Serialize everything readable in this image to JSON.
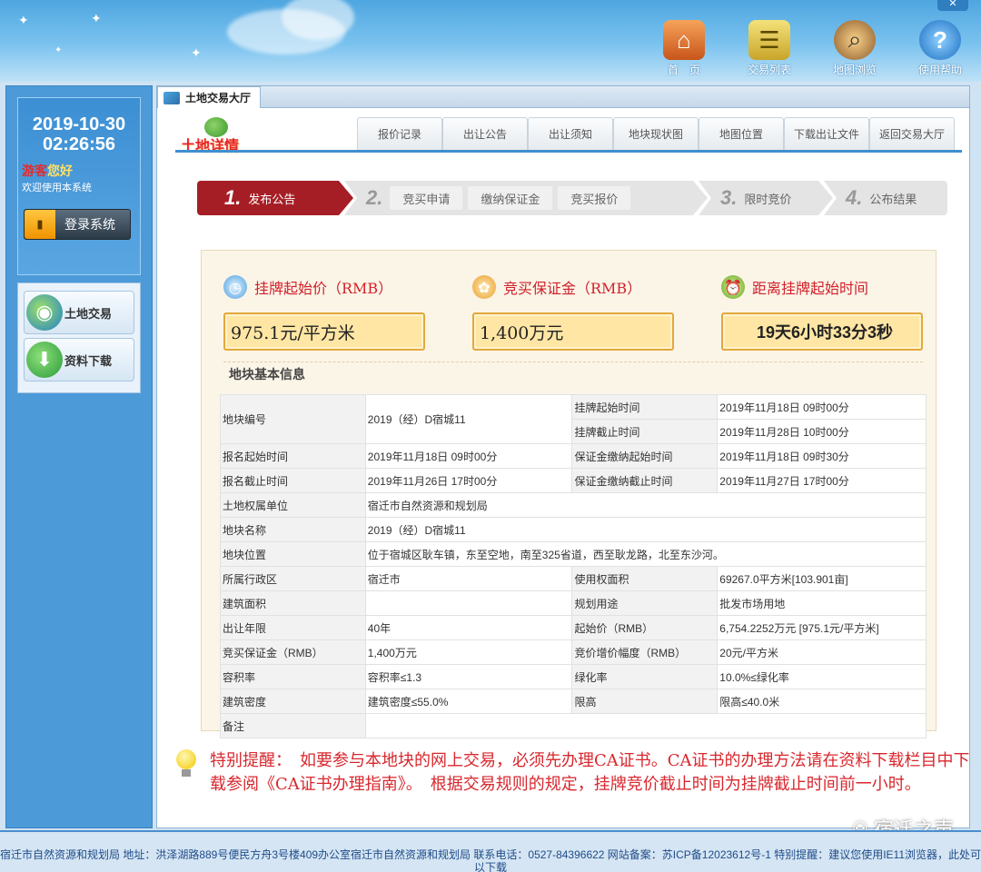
{
  "topnav": [
    {
      "label": "首　页",
      "icon": "home-icon"
    },
    {
      "label": "交易列表",
      "icon": "list-icon"
    },
    {
      "label": "地图浏览",
      "icon": "map-magnifier-icon"
    },
    {
      "label": "使用帮助",
      "icon": "help-icon"
    }
  ],
  "left": {
    "date": "2019-10-30",
    "time": "02:26:56",
    "guest": "游客",
    "hello": "您好",
    "welcome": "欢迎使用本系统",
    "login_label": "登录系统",
    "menu": [
      {
        "label": "土地交易",
        "icon": "globe-icon"
      },
      {
        "label": "资料下载",
        "icon": "download-icon"
      }
    ]
  },
  "main": {
    "tab_label": "土地交易大厅",
    "detail_title": "土地详情",
    "subtabs": [
      "报价记录",
      "出让公告",
      "出让须知",
      "地块现状图",
      "地图位置",
      "下载出让文件",
      "返回交易大厅"
    ],
    "steps": {
      "s1_num": "1.",
      "s1_label": "发布公告",
      "s2_num": "2.",
      "s2_subs": [
        "竞买申请",
        "缴纳保证金",
        "竞买报价"
      ],
      "s3_num": "3.",
      "s3_label": "限时竞价",
      "s4_num": "4.",
      "s4_label": "公布结果"
    },
    "summary": {
      "start_price_label": "挂牌起始价（RMB）",
      "start_price_value": "975.1元/平方米",
      "deposit_label": "竞买保证金（RMB）",
      "deposit_value": "1,400万元",
      "countdown_label": "距离挂牌起始时间",
      "countdown_value": "19天6小时33分3秒"
    },
    "basic_title": "地块基本信息",
    "table": {
      "r1": {
        "k": "地块编号",
        "v": "2019（经）D宿城11",
        "k2a": "挂牌起始时间",
        "v2a": "2019年11月18日 09时00分",
        "k2b": "挂牌截止时间",
        "v2b": "2019年11月28日 10时00分"
      },
      "r2": {
        "k": "报名起始时间",
        "v": "2019年11月18日 09时00分",
        "k2": "保证金缴纳起始时间",
        "v2": "2019年11月18日 09时30分"
      },
      "r3": {
        "k": "报名截止时间",
        "v": "2019年11月26日 17时00分",
        "k2": "保证金缴纳截止时间",
        "v2": "2019年11月27日 17时00分"
      },
      "r4": {
        "k": "土地权属单位",
        "v": "宿迁市自然资源和规划局"
      },
      "r5": {
        "k": "地块名称",
        "v": "2019（经）D宿城11"
      },
      "r6": {
        "k": "地块位置",
        "v": "位于宿城区耿车镇，东至空地，南至325省道，西至耿龙路，北至东沙河。"
      },
      "r7": {
        "k": "所属行政区",
        "v": "宿迁市",
        "k2": "使用权面积",
        "v2": "69267.0平方米[103.901亩]"
      },
      "r8": {
        "k": "建筑面积",
        "v": "",
        "k2": "规划用途",
        "v2": "批发市场用地"
      },
      "r9": {
        "k": "出让年限",
        "v": "40年",
        "k2": "起始价（RMB）",
        "v2": "6,754.2252万元 [975.1元/平方米]"
      },
      "r10": {
        "k": "竞买保证金（RMB）",
        "v": "1,400万元",
        "k2": "竞价增价幅度（RMB）",
        "v2": "20元/平方米"
      },
      "r11": {
        "k": "容积率",
        "v": "容积率≤1.3",
        "k2": "绿化率",
        "v2": "10.0%≤绿化率"
      },
      "r12": {
        "k": "建筑密度",
        "v": "建筑密度≤55.0%",
        "k2": "限高",
        "v2": "限高≤40.0米"
      },
      "r13": {
        "k": "备注",
        "v": ""
      }
    },
    "tip": "特别提醒：　如要参与本地块的网上交易，必须先办理CA证书。CA证书的办理方法请在资料下载栏目中下载参阅《CA证书办理指南》。　根据交易规则的规定，挂牌竞价截止时间为挂牌截止时间前一小时。"
  },
  "footer": "宿迁市自然资源和规划局 地址：洪泽湖路889号便民方舟3号楼409办公室宿迁市自然资源和规划局 联系电话：0527-84396622 网站备案：苏ICP备12023612号-1 特别提醒：建议您使用IE11浏览器，此处可以下载",
  "watermark": "宿迁之声"
}
